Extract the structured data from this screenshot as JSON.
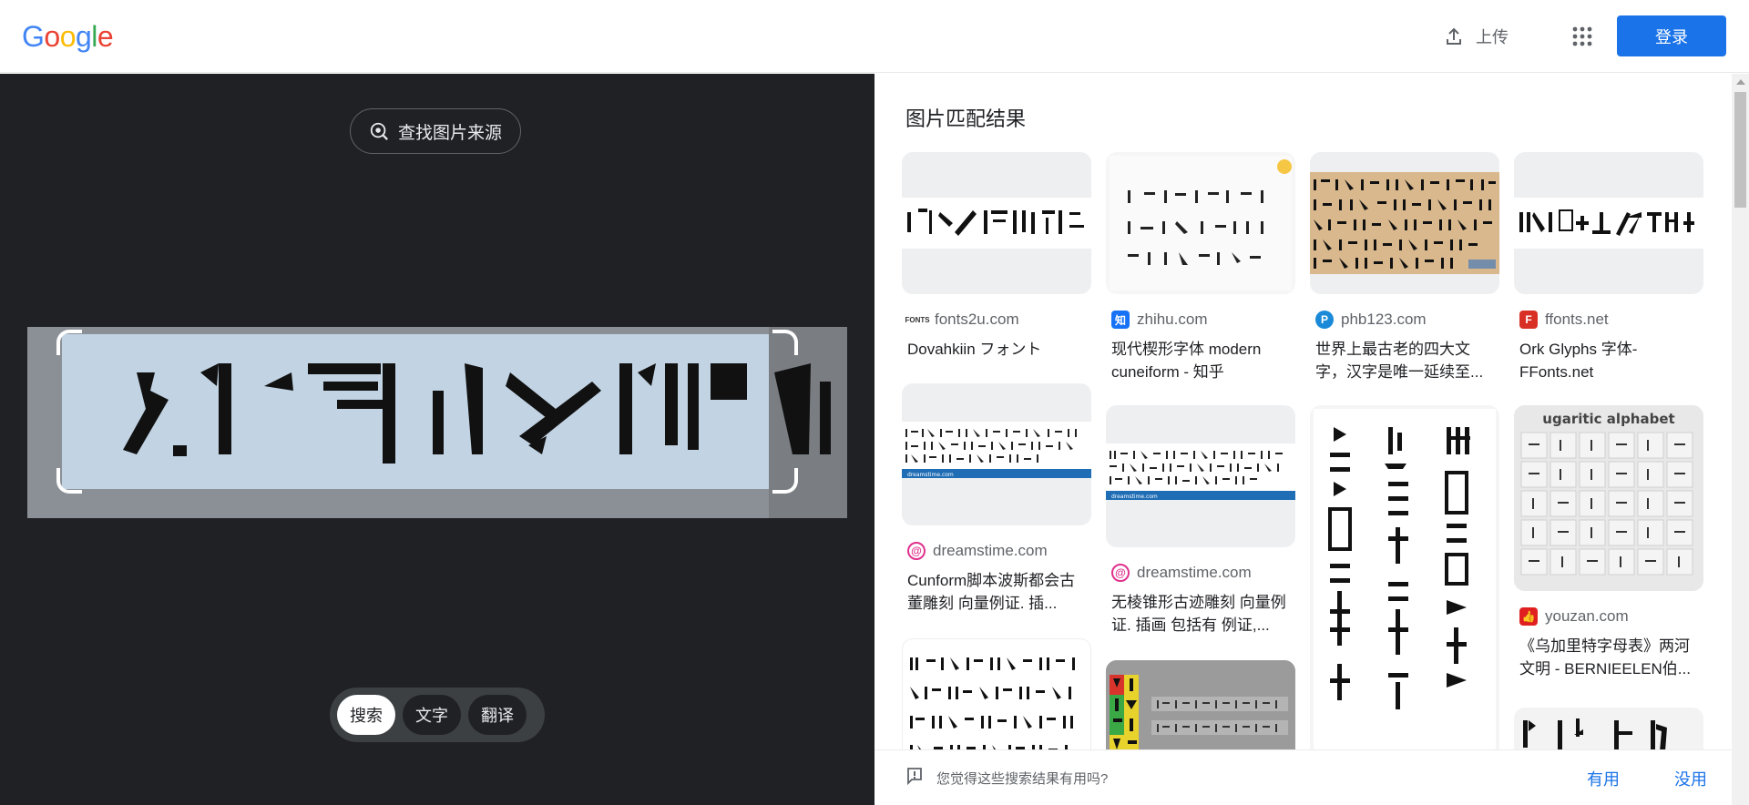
{
  "header": {
    "logo": "Google",
    "upload_label": "上传",
    "signin_label": "登录"
  },
  "lens": {
    "find_source_label": "查找图片来源",
    "modes": [
      "搜索",
      "文字",
      "翻译"
    ],
    "active_mode": "搜索"
  },
  "results": {
    "title": "图片匹配结果",
    "items": [
      {
        "source": "fonts2u.com",
        "title": "Dovahkiin フォント",
        "favicon": "fonts2u",
        "fav_color": "#ffffff"
      },
      {
        "source": "zhihu.com",
        "title": "现代楔形字体 modern cuneiform - 知乎",
        "favicon": "知",
        "fav_color": "#1772f6"
      },
      {
        "source": "phb123.com",
        "title": "世界上最古老的四大文字，汉字是唯一延续至...",
        "favicon": "phb",
        "fav_color": "#1a8ad8"
      },
      {
        "source": "ffonts.net",
        "title": "Ork Glyphs 字体- FFonts.net",
        "favicon": "ff",
        "fav_color": "#d93025"
      },
      {
        "source": "dreamstime.com",
        "title": "Cunform脚本波斯都会古董雕刻 向量例证. 插...",
        "favicon": "dreamstime",
        "fav_color": "#e0318d"
      },
      {
        "source": "dreamstime.com",
        "title": "无棱锥形古迹雕刻 向量例证. 插画 包括有 例证,...",
        "favicon": "dreamstime",
        "fav_color": "#e0318d"
      },
      {
        "source": "youzan.com",
        "title": "《乌加里特字母表》两河文明 - BERNIEELEN伯...",
        "favicon": "youzan",
        "fav_color": "#e02020"
      }
    ],
    "thumb_text_ugaritic": "ugaritic alphabet",
    "thumb_text_dreamstime": "dreamstime.com"
  },
  "feedback": {
    "question": "您觉得这些搜索结果有用吗?",
    "yes_label": "有用",
    "no_label": "没用"
  }
}
